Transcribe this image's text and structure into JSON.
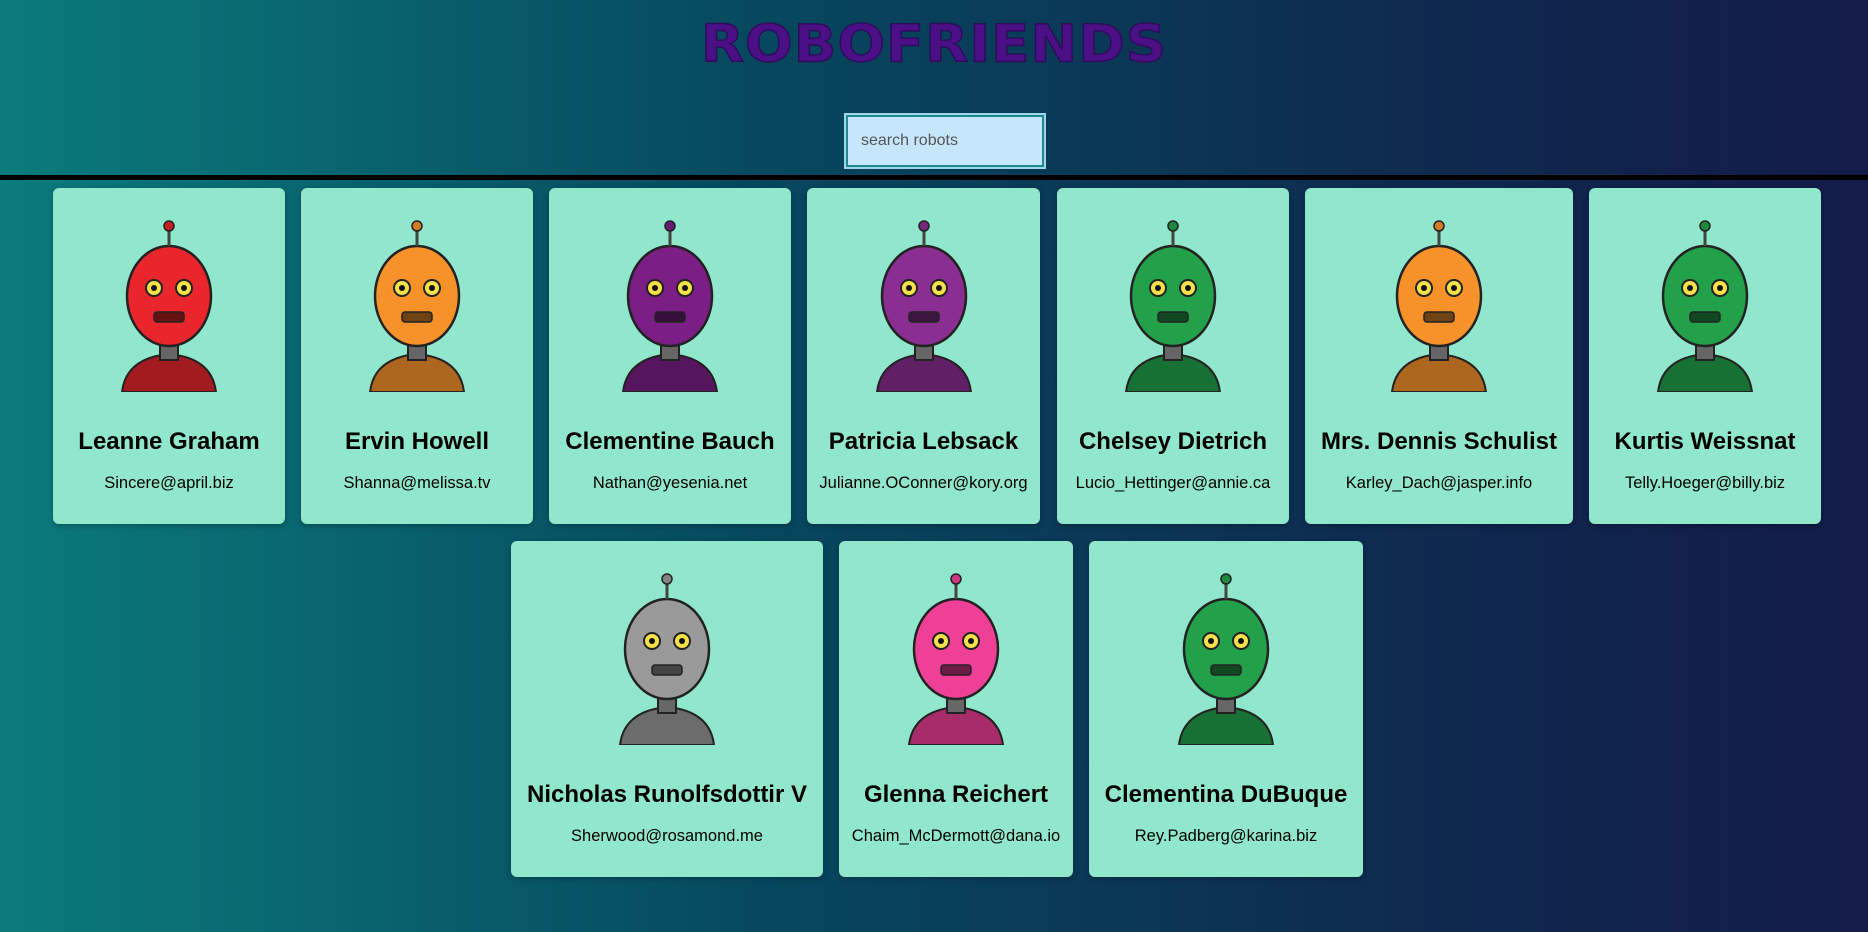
{
  "app": {
    "title": "ROBOFRIENDS",
    "search_placeholder": "search robots"
  },
  "robots": [
    {
      "name": "Leanne Graham",
      "email": "Sincere@april.biz",
      "color": "#e8262b",
      "icon": "red-robot-icon"
    },
    {
      "name": "Ervin Howell",
      "email": "Shanna@melissa.tv",
      "color": "#f7922a",
      "icon": "orange-robot-icon"
    },
    {
      "name": "Clementine Bauch",
      "email": "Nathan@yesenia.net",
      "color": "#7b1f86",
      "icon": "purple-robot-icon"
    },
    {
      "name": "Patricia Lebsack",
      "email": "Julianne.OConner@kory.org",
      "color": "#8a2e91",
      "icon": "purple-robot-icon"
    },
    {
      "name": "Chelsey Dietrich",
      "email": "Lucio_Hettinger@annie.ca",
      "color": "#22a14a",
      "icon": "green-robot-icon"
    },
    {
      "name": "Mrs. Dennis Schulist",
      "email": "Karley_Dach@jasper.info",
      "color": "#f7922a",
      "icon": "orange-robot-icon"
    },
    {
      "name": "Kurtis Weissnat",
      "email": "Telly.Hoeger@billy.biz",
      "color": "#22a14a",
      "icon": "green-robot-icon"
    },
    {
      "name": "Nicholas Runolfsdottir V",
      "email": "Sherwood@rosamond.me",
      "color": "#9a9a9a",
      "icon": "gray-robot-icon"
    },
    {
      "name": "Glenna Reichert",
      "email": "Chaim_McDermott@dana.io",
      "color": "#ef3f96",
      "icon": "pink-robot-icon"
    },
    {
      "name": "Clementina DuBuque",
      "email": "Rey.Padberg@karina.biz",
      "color": "#22a14a",
      "icon": "green-robot-icon"
    }
  ]
}
